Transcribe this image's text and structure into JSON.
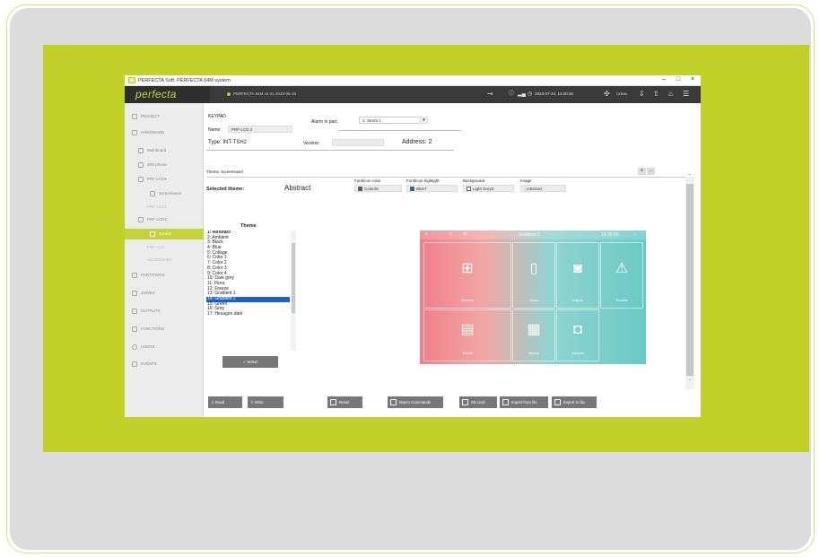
{
  "window": {
    "title": "PERFECTA Soft: PERFECTA 64M system",
    "controls": [
      "–",
      "□",
      "×"
    ]
  },
  "header": {
    "logo": "perfecta",
    "status": "PERFECTA 64M v2.01 2023-06-10",
    "datetime": "2023-07-24, 13:20:45",
    "conn": "CONN."
  },
  "sidebar": {
    "items": [
      {
        "label": "PROJECT"
      },
      {
        "label": "HARDWARE"
      },
      {
        "label": "Mainboard"
      },
      {
        "label": "SIM phone"
      },
      {
        "label": "PRF-LCD1"
      },
      {
        "label": "Screensaver"
      },
      {
        "label": "PRF-LCD1"
      },
      {
        "label": "PRF-LCD2"
      },
      {
        "label": "Screen"
      },
      {
        "label": "PRF-LCD"
      },
      {
        "label": "ACCESSORY"
      },
      {
        "label": "PARTITIONS"
      },
      {
        "label": "ZONES"
      },
      {
        "label": "OUTPUTS"
      },
      {
        "label": "FUNCTIONS"
      },
      {
        "label": "USERS"
      },
      {
        "label": "EVENTS"
      }
    ]
  },
  "keypad": {
    "section": "KEYPAD",
    "name_label": "Name:",
    "name_value": "PRF-LCD 2",
    "alarm_label": "Alarm in part.:",
    "alarm_value": "1: Strefa 1",
    "type_label": "Type: INT-TSH2",
    "version_label": "Version:",
    "address_label": "Address: 2"
  },
  "theme": {
    "tab_label": "Theme",
    "tab_active": "Screensaver",
    "selected_label": "Selected theme:",
    "selected_value": "Abstract",
    "font_color_label": "Font/icon color",
    "font_color_value": "Color25",
    "font_highlight_label": "Font/icon highlight",
    "font_highlight_value": "Blue7",
    "background_label": "Background",
    "background_value": "Light Grey3",
    "image_label": "Image",
    "image_value": "..\\Abstract",
    "list_header": "Theme",
    "list": [
      "1: Abstract",
      "2: Ambient",
      "3: Black",
      "4: Blue",
      "5: Collage",
      "6: Color 1",
      "7: Color 2",
      "8: Color 3",
      "9: Color 4",
      "10: Dark grey",
      "11: Flora",
      "12: Freeze",
      "13: Gradient 1",
      "14: Gradient 2",
      "15: Green",
      "16: Grey",
      "17: Hexagon dark"
    ],
    "selected_index": 13,
    "select_button": "Select",
    "plus": "+",
    "minus": "-"
  },
  "preview": {
    "title": "Gradient 2",
    "time": "13:35:05",
    "tiles": [
      "Partitions",
      "Zones",
      "Outputs",
      "Troubles",
      "Events",
      "Macros",
      "Cameras"
    ]
  },
  "buttons": {
    "read": "Read",
    "write": "Write",
    "reset": "Reset",
    "macro": "Macro Commands",
    "sd": "SD card",
    "import": "Import from file",
    "export": "Export to file"
  },
  "colors": {
    "lime": "#c2d02a",
    "selection": "#1a63c6",
    "header": "#3a3a3a",
    "gradient_left": "#f07e8a",
    "gradient_right": "#6ac9c5"
  }
}
